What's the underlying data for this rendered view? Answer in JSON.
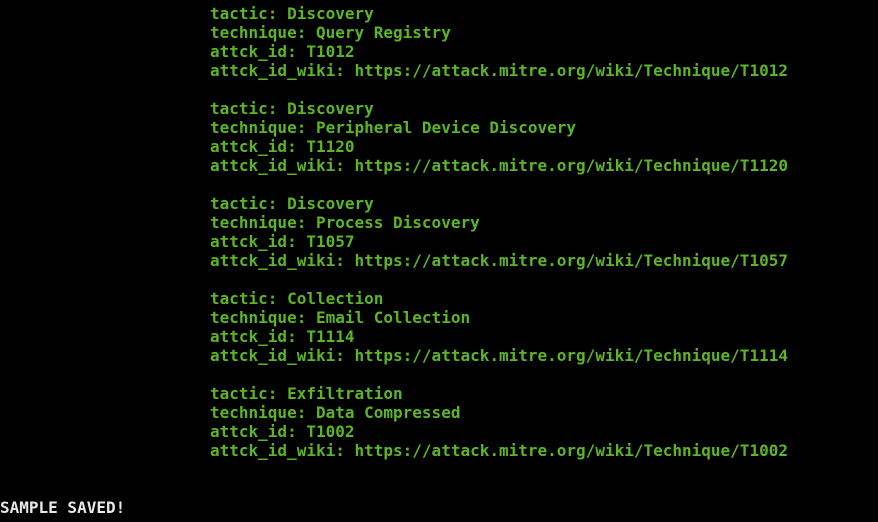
{
  "terminal": {
    "text_color": "#5cb526",
    "status_color": "#e8e8e8",
    "entries": [
      {
        "tactic": "tactic: Discovery",
        "technique": "technique: Query Registry",
        "attck_id": "attck_id: T1012",
        "attck_id_wiki": "attck_id_wiki: https://attack.mitre.org/wiki/Technique/T1012"
      },
      {
        "tactic": "tactic: Discovery",
        "technique": "technique: Peripheral Device Discovery",
        "attck_id": "attck_id: T1120",
        "attck_id_wiki": "attck_id_wiki: https://attack.mitre.org/wiki/Technique/T1120"
      },
      {
        "tactic": "tactic: Discovery",
        "technique": "technique: Process Discovery",
        "attck_id": "attck_id: T1057",
        "attck_id_wiki": "attck_id_wiki: https://attack.mitre.org/wiki/Technique/T1057"
      },
      {
        "tactic": "tactic: Collection",
        "technique": "technique: Email Collection",
        "attck_id": "attck_id: T1114",
        "attck_id_wiki": "attck_id_wiki: https://attack.mitre.org/wiki/Technique/T1114"
      },
      {
        "tactic": "tactic: Exfiltration",
        "technique": "technique: Data Compressed",
        "attck_id": "attck_id: T1002",
        "attck_id_wiki": "attck_id_wiki: https://attack.mitre.org/wiki/Technique/T1002"
      }
    ],
    "status": "SAMPLE SAVED!"
  }
}
